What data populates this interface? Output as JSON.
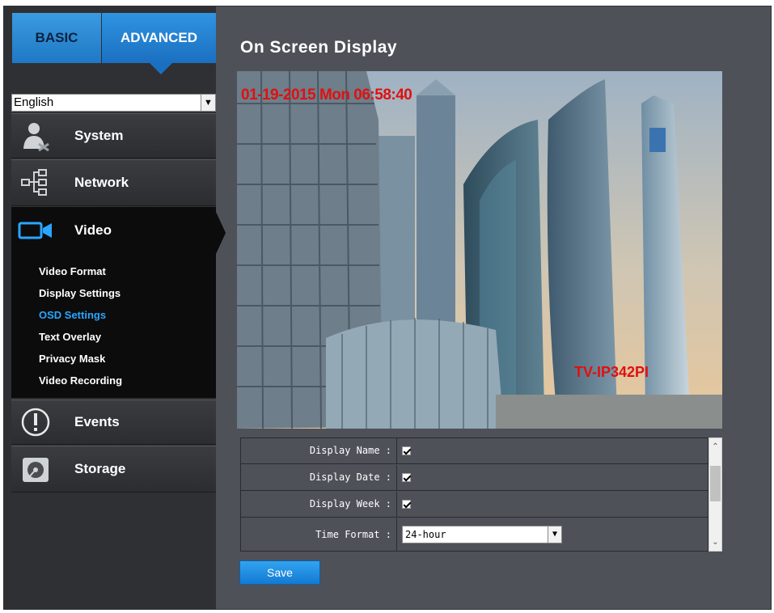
{
  "tabs": {
    "basic": "BASIC",
    "advanced": "ADVANCED"
  },
  "language": {
    "selected": "English"
  },
  "menu": {
    "system": "System",
    "network": "Network",
    "video": "Video",
    "events": "Events",
    "storage": "Storage"
  },
  "video_submenu": {
    "video_format": "Video Format",
    "display_settings": "Display Settings",
    "osd_settings": "OSD Settings",
    "text_overlay": "Text Overlay",
    "privacy_mask": "Privacy Mask",
    "video_recording": "Video Recording"
  },
  "active_submenu": "OSD Settings",
  "page": {
    "title": "On Screen Display"
  },
  "preview": {
    "osd_datetime": "01-19-2015 Mon 06:58:40",
    "osd_camera_name": "TV-IP342PI"
  },
  "settings": {
    "display_name_label": "Display Name :",
    "display_date_label": "Display Date :",
    "display_week_label": "Display Week :",
    "time_format_label": "Time Format :",
    "time_format_value": "24-hour"
  },
  "actions": {
    "save_label": "Save"
  },
  "colors": {
    "accent": "#1f78c4",
    "active_link": "#2aa6ff",
    "osd_text": "#e01010",
    "panel": "#4e5158"
  }
}
